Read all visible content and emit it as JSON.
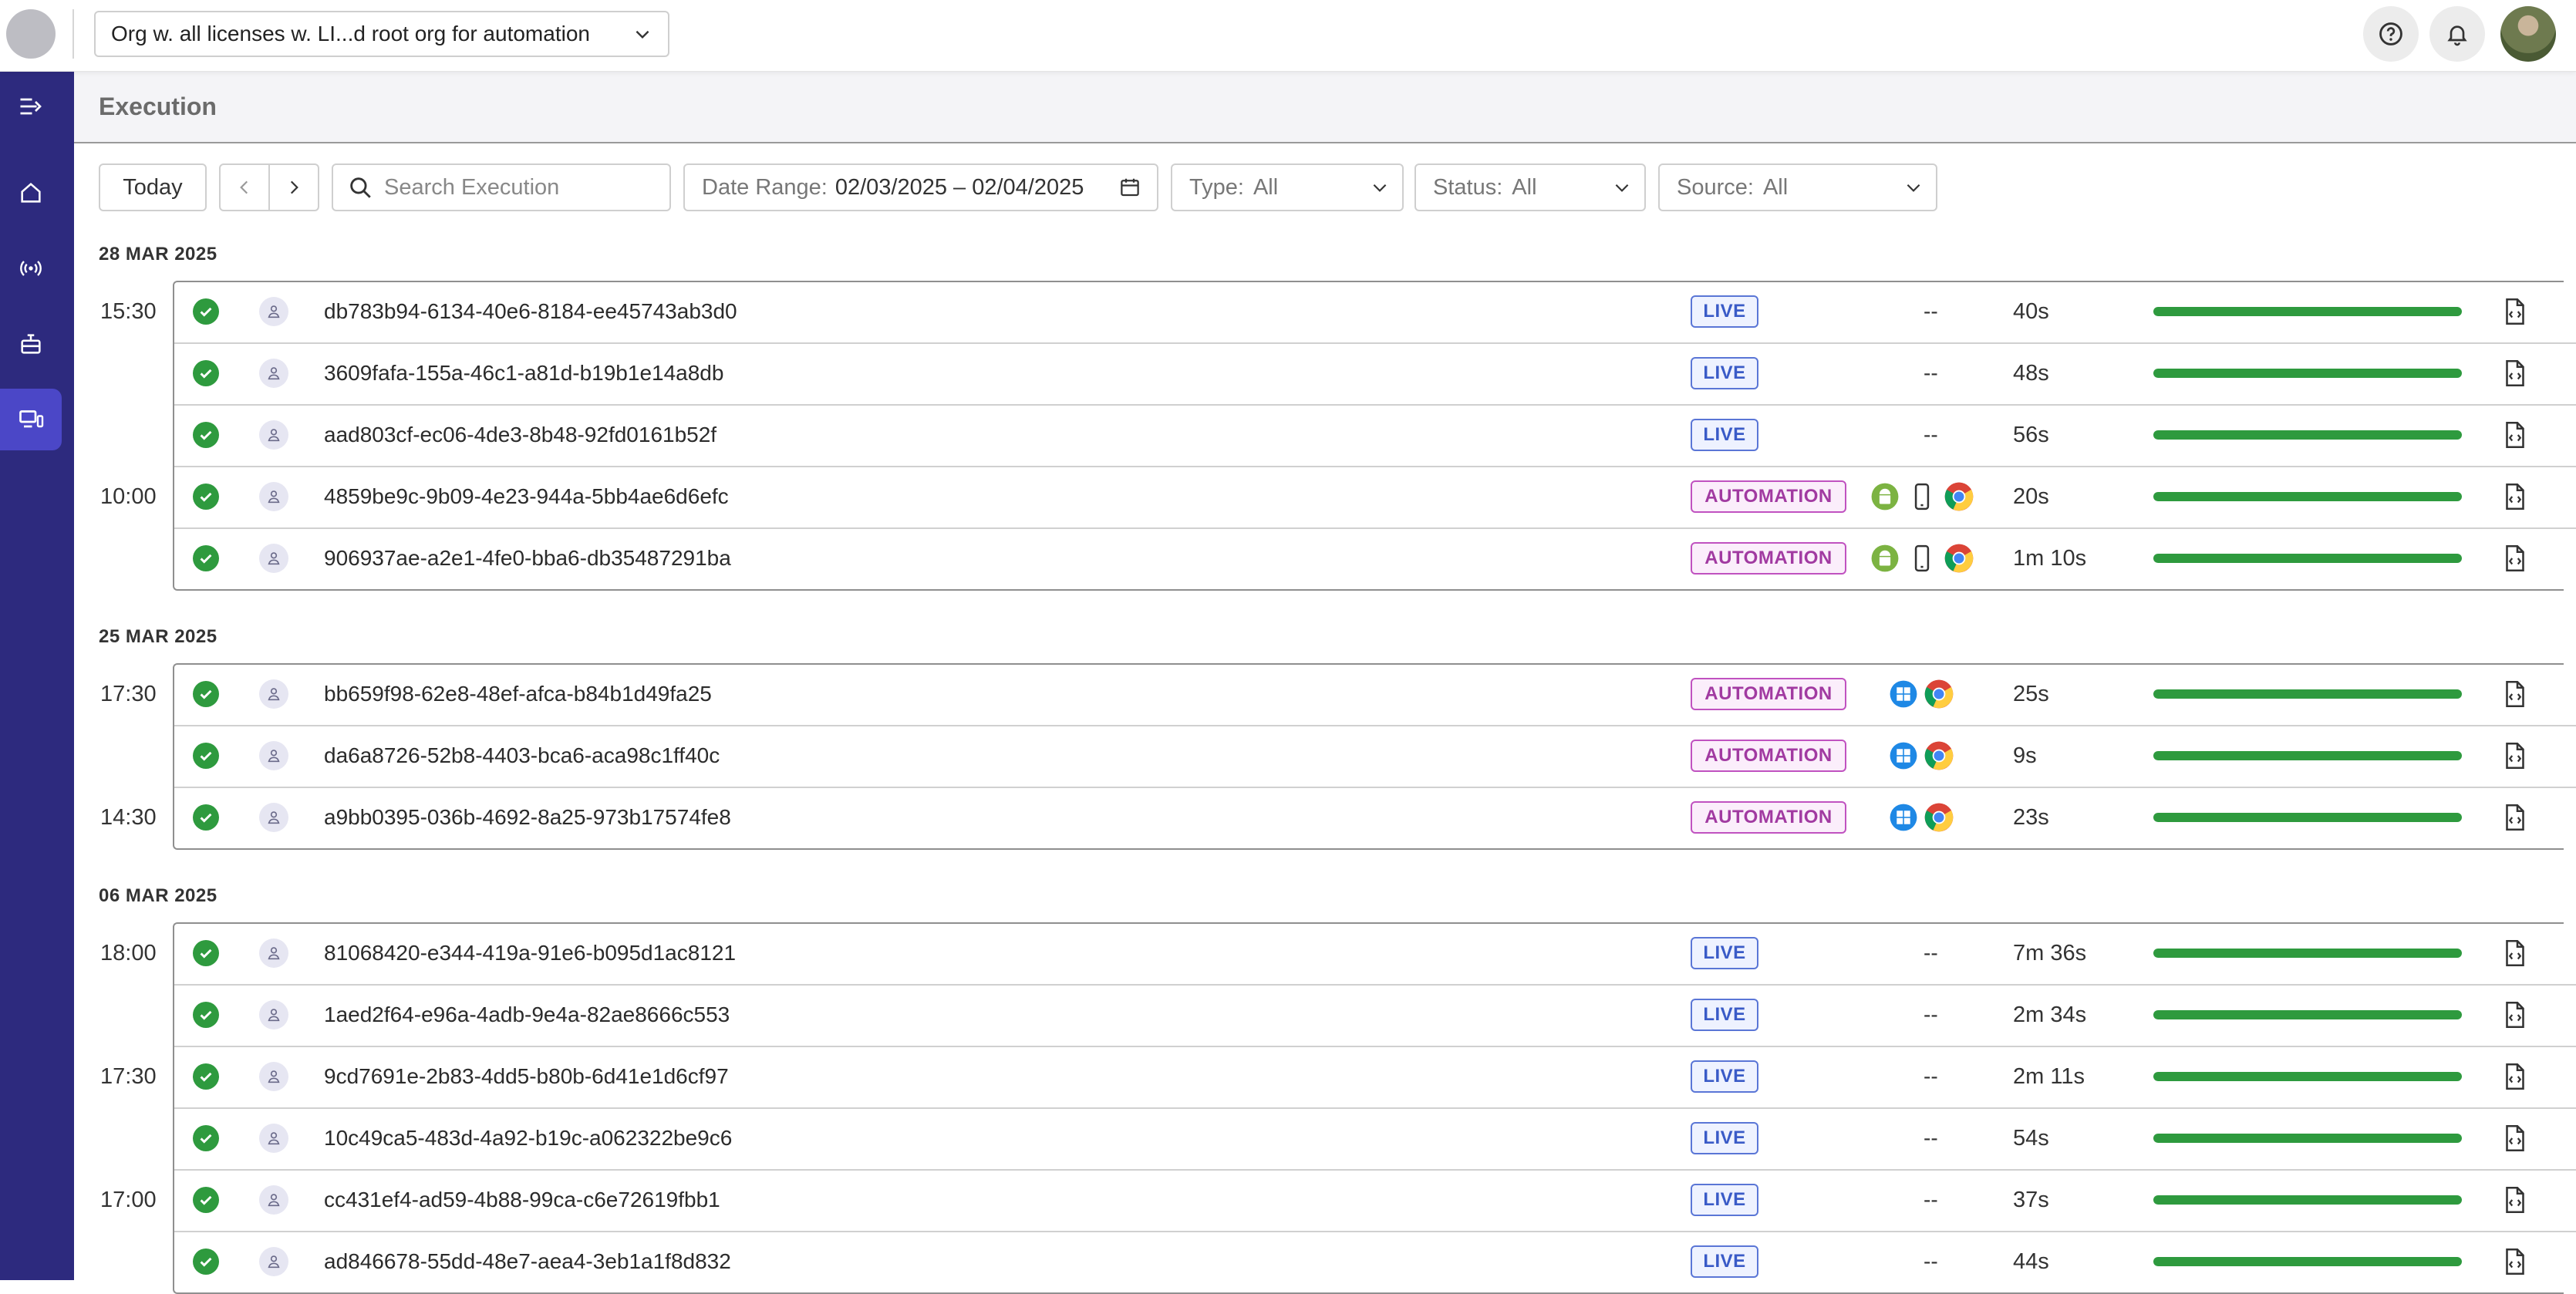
{
  "topbar": {
    "org_selector": "Org w. all licenses w. LI...d root org for automation"
  },
  "page": {
    "title": "Execution"
  },
  "filters": {
    "today": "Today",
    "search_placeholder": "Search Execution",
    "date_range_label": "Date Range:",
    "date_range_value": "02/03/2025 – 02/04/2025",
    "type_label": "Type:",
    "type_value": "All",
    "status_label": "Status:",
    "status_value": "All",
    "source_label": "Source:",
    "source_value": "All"
  },
  "groups": [
    {
      "date": "28 MAR 2025",
      "rows": [
        {
          "time": "15:30",
          "id": "db783b94-6134-40e6-8184-ee45743ab3d0",
          "type": "LIVE",
          "platforms": "--",
          "duration": "40s"
        },
        {
          "time": "",
          "id": "3609fafa-155a-46c1-a81d-b19b1e14a8db",
          "type": "LIVE",
          "platforms": "--",
          "duration": "48s"
        },
        {
          "time": "",
          "id": "aad803cf-ec06-4de3-8b48-92fd0161b52f",
          "type": "LIVE",
          "platforms": "--",
          "duration": "56s"
        },
        {
          "time": "10:00",
          "id": "4859be9c-9b09-4e23-944a-5bb4ae6d6efc",
          "type": "AUTOMATION",
          "platforms": "android-mobile-chrome",
          "duration": "20s"
        },
        {
          "time": "",
          "id": "906937ae-a2e1-4fe0-bba6-db35487291ba",
          "type": "AUTOMATION",
          "platforms": "android-mobile-chrome",
          "duration": "1m 10s"
        }
      ]
    },
    {
      "date": "25 MAR 2025",
      "rows": [
        {
          "time": "17:30",
          "id": "bb659f98-62e8-48ef-afca-b84b1d49fa25",
          "type": "AUTOMATION",
          "platforms": "windows-chrome",
          "duration": "25s"
        },
        {
          "time": "",
          "id": "da6a8726-52b8-4403-bca6-aca98c1ff40c",
          "type": "AUTOMATION",
          "platforms": "windows-chrome",
          "duration": "9s"
        },
        {
          "time": "14:30",
          "id": "a9bb0395-036b-4692-8a25-973b17574fe8",
          "type": "AUTOMATION",
          "platforms": "windows-chrome",
          "duration": "23s"
        }
      ]
    },
    {
      "date": "06 MAR 2025",
      "rows": [
        {
          "time": "18:00",
          "id": "81068420-e344-419a-91e6-b095d1ac8121",
          "type": "LIVE",
          "platforms": "--",
          "duration": "7m 36s"
        },
        {
          "time": "",
          "id": "1aed2f64-e96a-4adb-9e4a-82ae8666c553",
          "type": "LIVE",
          "platforms": "--",
          "duration": "2m 34s"
        },
        {
          "time": "17:30",
          "id": "9cd7691e-2b83-4dd5-b80b-6d41e1d6cf97",
          "type": "LIVE",
          "platforms": "--",
          "duration": "2m 11s"
        },
        {
          "time": "",
          "id": "10c49ca5-483d-4a92-b19c-a062322be9c6",
          "type": "LIVE",
          "platforms": "--",
          "duration": "54s"
        },
        {
          "time": "17:00",
          "id": "cc431ef4-ad59-4b88-99ca-c6e72619fbb1",
          "type": "LIVE",
          "platforms": "--",
          "duration": "37s"
        },
        {
          "time": "",
          "id": "ad846678-55dd-48e7-aea4-3eb1a1f8d832",
          "type": "LIVE",
          "platforms": "--",
          "duration": "44s"
        }
      ]
    }
  ],
  "colors": {
    "sidebar": "#2d2a7e",
    "sidebar_active": "#4b47c7",
    "success": "#2e9a3e",
    "live": "#3a5bc7",
    "automation": "#a13aa1"
  }
}
